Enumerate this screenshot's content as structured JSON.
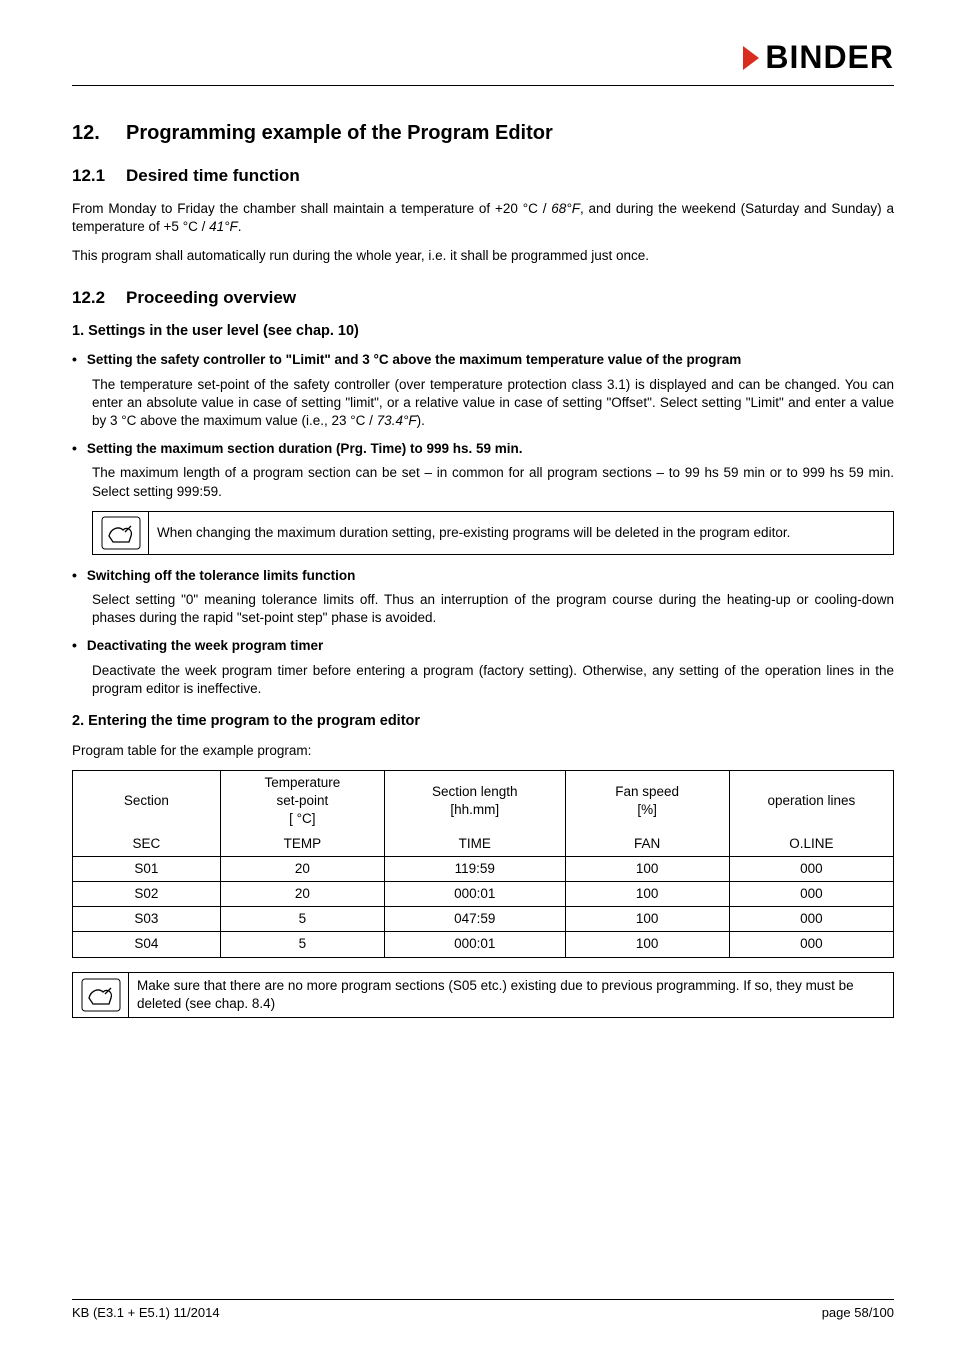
{
  "logo": {
    "brand": "BINDER"
  },
  "h1": {
    "num": "12.",
    "title": "Programming example of the Program Editor"
  },
  "s12_1": {
    "num": "12.1",
    "title": "Desired time function",
    "p1a": "From Monday to Friday the chamber shall maintain a temperature of +20 °C / ",
    "p1b": "68°F",
    "p1c": ", and during the weekend (Saturday and Sunday) a temperature of +5 °C / ",
    "p1d": "41°F",
    "p1e": ".",
    "p2": "This program shall automatically run during the whole year, i.e. it shall be programmed just once."
  },
  "s12_2": {
    "num": "12.2",
    "title": "Proceeding overview",
    "h3_1": "1. Settings in the user level (see chap. 10)",
    "bullets": [
      {
        "head": "Setting the safety controller to \"Limit\" and 3 °C above the maximum temperature value of the program",
        "body": "The temperature set-point of the safety controller (over temperature protection class 3.1) is displayed and can be changed. You can enter an absolute value in case of setting \"limit\", or a relative value in case of setting \"Offset\". Select setting \"Limit\" and enter a value by 3 °C above the maximum value (i.e., 23 °C / ",
        "body_italic": "73.4°F",
        "body_tail": ")."
      },
      {
        "head": "Setting the maximum section duration (Prg. Time) to 999 hs. 59 min.",
        "body": "The maximum length of a program section can be set – in common for all program sections – to 99 hs 59 min or to 999 hs 59 min. Select setting 999:59."
      },
      {
        "head": "Switching off the tolerance limits function",
        "body": "Select setting \"0\" meaning tolerance limits off. Thus an interruption of the program course during the heating-up or cooling-down phases during the rapid \"set-point step\" phase is avoided."
      },
      {
        "head": "Deactivating the week program timer",
        "body": "Deactivate the week program timer before entering a program (factory setting). Otherwise, any setting of the operation lines in the program editor is ineffective."
      }
    ],
    "callout1": "When changing the maximum duration setting, pre-existing programs will be deleted in the program editor.",
    "h3_2": "2. Entering the time program to the program editor",
    "p_table_intro": "Program table for the example program:",
    "callout2": "Make sure that there are no more program sections (S05 etc.) existing due to previous programming. If so, they must be deleted (see chap. 8.4)"
  },
  "table": {
    "headers_top": [
      "Section",
      "Temperature set-point [ °C]",
      "Section length [hh.mm]",
      "Fan speed [%]",
      "operation lines"
    ],
    "headers_bot": [
      "SEC",
      "TEMP",
      "TIME",
      "FAN",
      "O.LINE"
    ],
    "rows": [
      [
        "S01",
        "20",
        "119:59",
        "100",
        "000"
      ],
      [
        "S02",
        "20",
        "000:01",
        "100",
        "000"
      ],
      [
        "S03",
        "5",
        "047:59",
        "100",
        "000"
      ],
      [
        "S04",
        "5",
        "000:01",
        "100",
        "000"
      ]
    ]
  },
  "footer": {
    "left": "KB (E3.1 + E5.1) 11/2014",
    "right": "page 58/100"
  }
}
